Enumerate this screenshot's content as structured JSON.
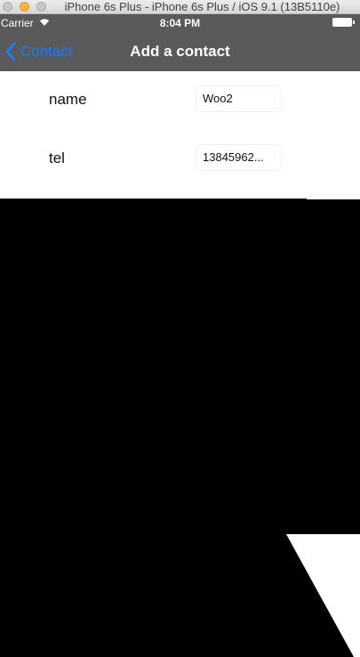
{
  "window": {
    "title": "iPhone 6s Plus - iPhone 6s Plus / iOS 9.1 (13B5110e)"
  },
  "status_bar": {
    "carrier": "Carrier",
    "time": "8:04 PM"
  },
  "nav": {
    "back_label": "Contact",
    "title": "Add a contact"
  },
  "form": {
    "rows": [
      {
        "label": "name",
        "value": "Woo2"
      },
      {
        "label": "tel",
        "value": "13845962..."
      }
    ]
  },
  "colors": {
    "accent": "#1e7bf0",
    "bar": "#5a5a5a"
  }
}
